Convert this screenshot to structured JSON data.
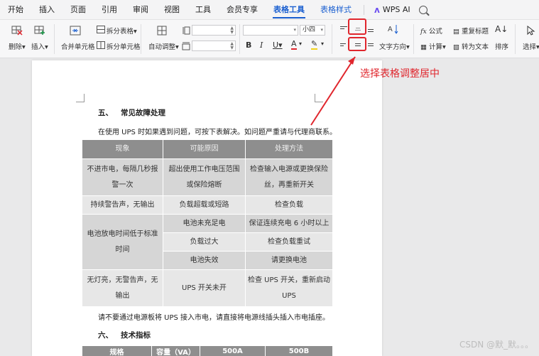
{
  "menubar": {
    "tabs": [
      "开始",
      "插入",
      "页面",
      "引用",
      "审阅",
      "视图",
      "工具",
      "会员专享"
    ],
    "context_tabs": [
      "表格工具",
      "表格样式"
    ],
    "wps_ai": "WPS AI"
  },
  "ribbon": {
    "delete": "删除",
    "insert": "插入",
    "merge": "合并单元格",
    "split_table": "拆分表格",
    "split_cells": "拆分单元格",
    "autofit": "自动调整",
    "font_size": "小四",
    "text_direction": "文字方向",
    "formula": "公式",
    "calculate": "计算",
    "repeat_header": "重复标题",
    "to_text": "转为文本",
    "sort": "排序",
    "select": "选择"
  },
  "annotation": "选择表格调整居中",
  "doc": {
    "section5_num": "五、",
    "section5_title": "常见故障处理",
    "intro": "在使用 UPS 时如果遇到问题，可按下表解决。如问题严重请与代理商联系。",
    "table_headers": [
      "现象",
      "可能原因",
      "处理方法"
    ],
    "rows": {
      "r1c1a": "不进市电，每隔几秒报",
      "r1c1b": "警一次",
      "r1c2a": "超出使用工作电压范围",
      "r1c2b": "或保险熔断",
      "r1c3a": "检查输入电源或更换保险",
      "r1c3b": "丝，再重新开关",
      "r2c1": "持续警告声，无输出",
      "r2c2": "负载超载或短路",
      "r2c3": "检查负载",
      "r3c1a": "电池放电时间低于标准",
      "r3c1b": "时间",
      "r3c2": "电池未充足电",
      "r3c3": "保证连续充电 6 小时以上",
      "r4c2": "负载过大",
      "r4c3": "检查负载重试",
      "r5c2": "电池失效",
      "r5c3": "请更换电池",
      "r6c1a": "无灯亮，无警告声，无",
      "r6c1b": "输出",
      "r6c2": "UPS 开关未开",
      "r6c3a": "检查 UPS 开关，重新启动",
      "r6c3b": "UPS"
    },
    "note": "请不要通过电源板将 UPS 接入市电，请直接将电源线插头插入市电插座。",
    "section6_num": "六、",
    "section6_title": "技术指标",
    "spec_headers": [
      "规格",
      "容量（VA）",
      "500A",
      "500B"
    ]
  },
  "watermark": "CSDN @默_默。。。"
}
